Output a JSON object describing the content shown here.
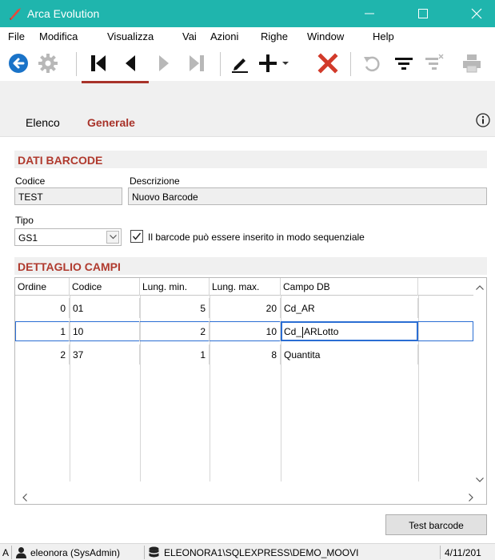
{
  "window": {
    "title": "Arca Evolution"
  },
  "menu": [
    "File",
    "Modifica",
    "Visualizza",
    "Vai",
    "Azioni",
    "Righe",
    "Window",
    "Help"
  ],
  "toolbar": {
    "icons": [
      "back-circle-icon",
      "gear-icon",
      "first-record-icon",
      "previous-record-icon",
      "next-record-icon",
      "last-record-icon",
      "edit-pencil-icon",
      "add-plus-icon",
      "dropdown-chevron-icon",
      "delete-x-icon",
      "undo-icon",
      "filter-icon",
      "clear-filter-icon",
      "print-icon"
    ],
    "accent": "#1a73c8",
    "delete_color": "#d23a2a"
  },
  "tabs": [
    {
      "label": "Elenco",
      "active": false
    },
    {
      "label": "Generale",
      "active": true
    }
  ],
  "form": {
    "section1": "DATI BARCODE",
    "codice_label": "Codice",
    "codice_value": "TEST",
    "descrizione_label": "Descrizione",
    "descrizione_value": "Nuovo Barcode",
    "tipo_label": "Tipo",
    "tipo_value": "GS1",
    "sequential_checked": true,
    "sequential_label": "Il barcode può essere inserito in modo sequenziale",
    "section2": "DETTAGLIO CAMPI"
  },
  "grid": {
    "headers": [
      "Ordine",
      "Codice",
      "Lung. min.",
      "Lung. max.",
      "Campo DB"
    ],
    "rows": [
      {
        "ordine": "0",
        "codice": "01",
        "min": "5",
        "max": "20",
        "campo": "Cd_AR"
      },
      {
        "ordine": "1",
        "codice": "10",
        "min": "2",
        "max": "10",
        "campo_a": "Cd_",
        "campo_b": "ARLotto"
      },
      {
        "ordine": "2",
        "codice": "37",
        "min": "1",
        "max": "8",
        "campo": "Quantita"
      }
    ],
    "selected_row": 1
  },
  "buttons": {
    "test_barcode": "Test barcode"
  },
  "status": {
    "prefix": "A",
    "user": "eleonora (SysAdmin)",
    "server": "ELEONORA1\\SQLEXPRESS\\DEMO_MOOVI",
    "date": "4/11/201"
  },
  "colors": {
    "titlebar": "#1fb5ad",
    "section_text": "#b03a2e",
    "tab_active": "#a8332a"
  }
}
